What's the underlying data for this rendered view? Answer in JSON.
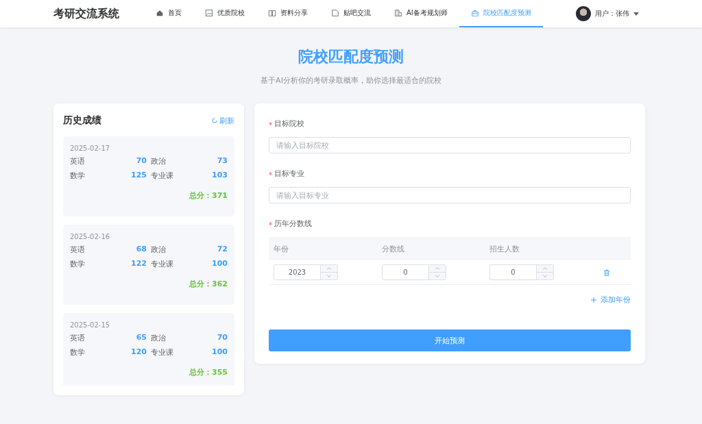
{
  "header": {
    "logo": "考研交流系统",
    "nav": [
      {
        "label": "首页",
        "selected": false
      },
      {
        "label": "优质院校",
        "selected": false
      },
      {
        "label": "资料分享",
        "selected": false
      },
      {
        "label": "贴吧交流",
        "selected": false
      },
      {
        "label": "AI备考规划师",
        "selected": false
      },
      {
        "label": "院校匹配度预测",
        "selected": true
      }
    ],
    "user": "用户：张伟"
  },
  "page": {
    "title": "院校匹配度预测",
    "subtitle": "基于AI分析你的考研录取概率，助你选择最适合的院校"
  },
  "history": {
    "title": "历史成绩",
    "refresh": "刷新",
    "records": [
      {
        "date": "2025-02-17",
        "scores": [
          {
            "subject": "英语",
            "score": "70"
          },
          {
            "subject": "政治",
            "score": "73"
          },
          {
            "subject": "数学",
            "score": "125"
          },
          {
            "subject": "专业课",
            "score": "103"
          }
        ],
        "total_label": "总分：",
        "total": "371"
      },
      {
        "date": "2025-02-16",
        "scores": [
          {
            "subject": "英语",
            "score": "68"
          },
          {
            "subject": "政治",
            "score": "72"
          },
          {
            "subject": "数学",
            "score": "122"
          },
          {
            "subject": "专业课",
            "score": "100"
          }
        ],
        "total_label": "总分：",
        "total": "362"
      },
      {
        "date": "2025-02-15",
        "scores": [
          {
            "subject": "英语",
            "score": "65"
          },
          {
            "subject": "政治",
            "score": "70"
          },
          {
            "subject": "数学",
            "score": "120"
          },
          {
            "subject": "专业课",
            "score": "100"
          }
        ],
        "total_label": "总分：",
        "total": "355"
      }
    ]
  },
  "form": {
    "fields": [
      {
        "label": "目标院校",
        "required": true,
        "placeholder": "请输入目标院校"
      },
      {
        "label": "目标专业",
        "required": true,
        "placeholder": "请输入目标专业"
      }
    ],
    "history_lines": {
      "label": "历年分数线",
      "required": true,
      "columns": [
        "年份",
        "分数线",
        "招生人数"
      ],
      "rows": [
        {
          "year": "2023",
          "score": "0",
          "count": "0"
        }
      ],
      "add": "添加年份"
    },
    "submit": "开始预测"
  }
}
